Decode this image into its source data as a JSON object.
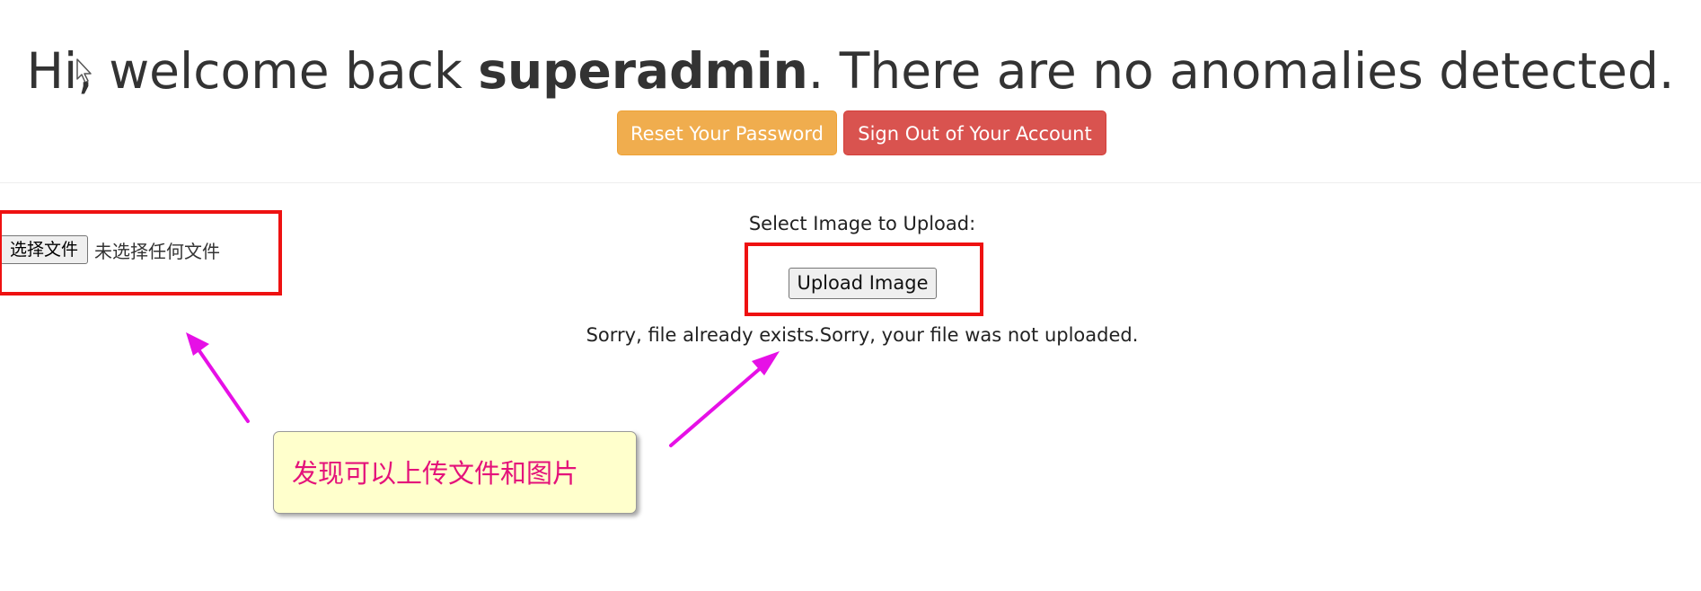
{
  "header": {
    "greeting_prefix": "Hi, welcome back ",
    "username": "superadmin",
    "greeting_suffix": ". There are no anomalies detected."
  },
  "actions": {
    "reset_password_label": "Reset Your Password",
    "sign_out_label": "Sign Out of Your Account"
  },
  "upload_form": {
    "choose_file_label": "选择文件",
    "no_file_selected": "未选择任何文件",
    "select_label": "Select Image to Upload:",
    "upload_button_label": "Upload Image",
    "result_message": "Sorry, file already exists.Sorry, your file was not uploaded."
  },
  "annotation": {
    "note_text": "发现可以上传文件和图片",
    "highlight_color": "#ee1111",
    "arrow_color": "#e610e6",
    "note_background": "#ffffcc",
    "note_text_color": "#e4127a"
  },
  "colors": {
    "warning": "#f0ad4e",
    "danger": "#d9534f"
  },
  "icons": {
    "cursor": "mouse-pointer-icon"
  }
}
